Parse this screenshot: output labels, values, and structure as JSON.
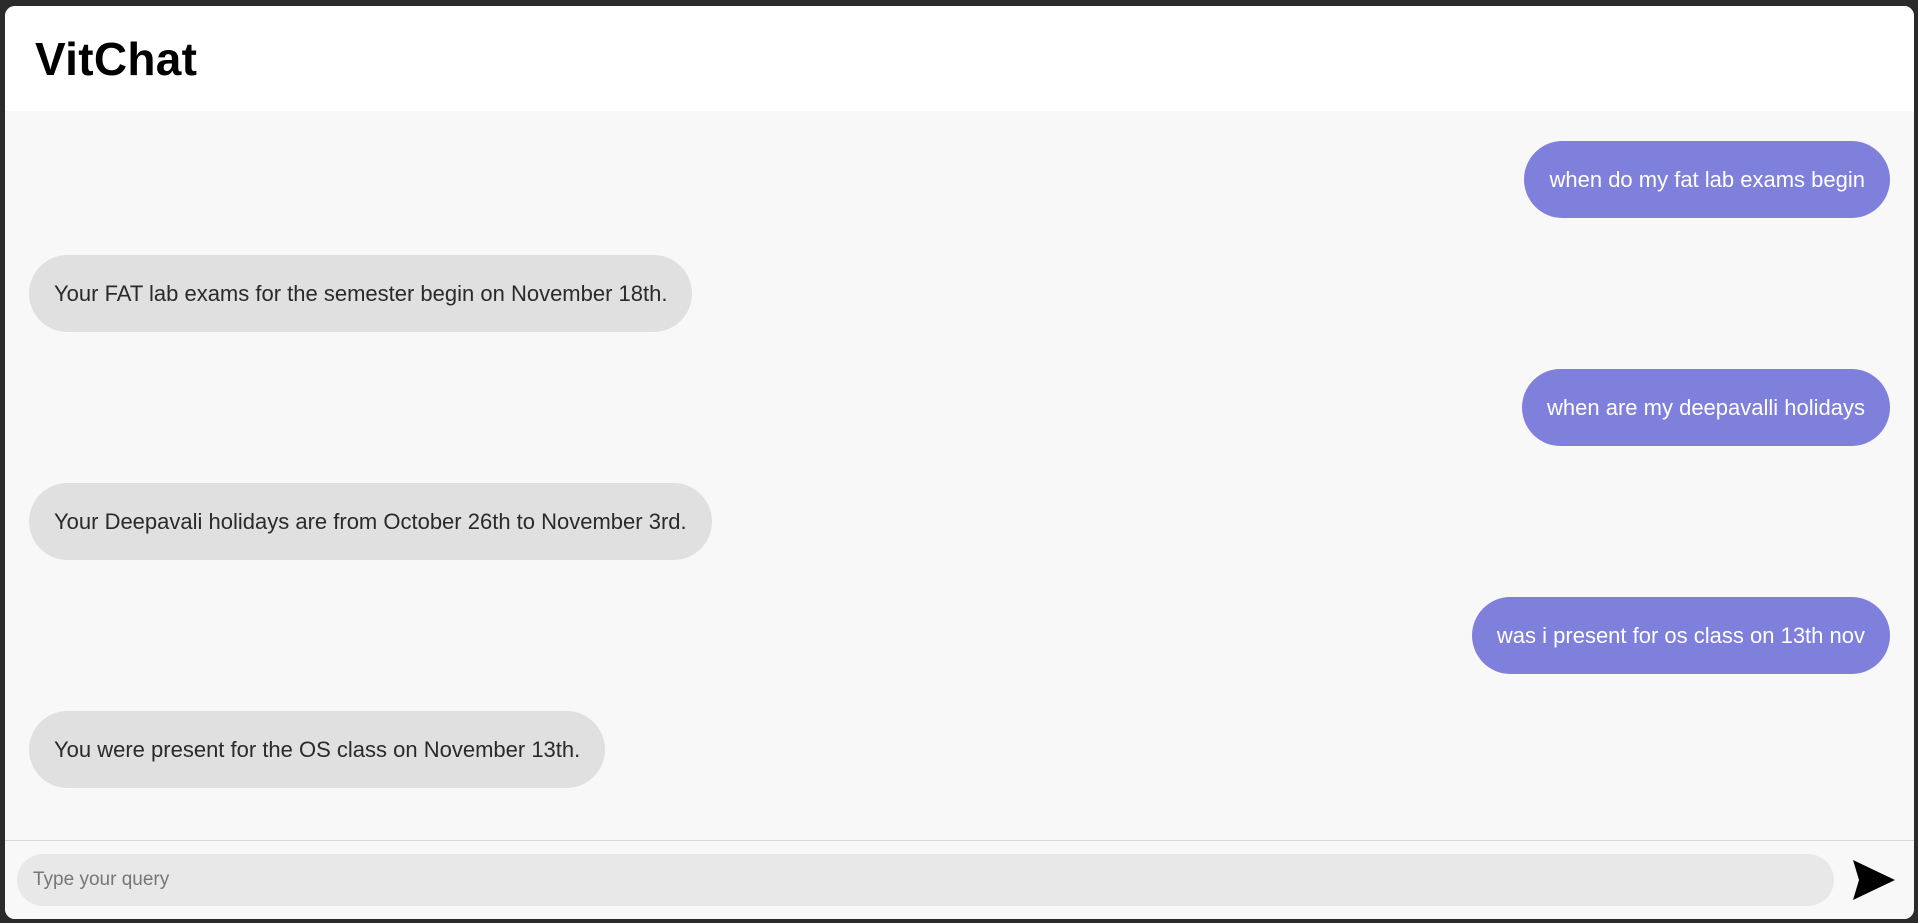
{
  "header": {
    "title": "VitChat"
  },
  "messages": [
    {
      "role": "user",
      "text": "when do my fat lab exams begin"
    },
    {
      "role": "bot",
      "text": "Your FAT lab exams for the semester begin on November 18th."
    },
    {
      "role": "user",
      "text": "when are my deepavalli holidays"
    },
    {
      "role": "bot",
      "text": "Your Deepavali holidays are from October 26th to November 3rd."
    },
    {
      "role": "user",
      "text": "was i present for os class on 13th nov"
    },
    {
      "role": "bot",
      "text": "You were present for the OS class on November 13th."
    }
  ],
  "input": {
    "placeholder": "Type your query",
    "value": ""
  },
  "send": {
    "icon": "send-arrow-icon"
  },
  "colors": {
    "user_bubble": "#7f7fdc",
    "bot_bubble": "#e0e0e0",
    "chat_background": "#f8f8f8"
  }
}
